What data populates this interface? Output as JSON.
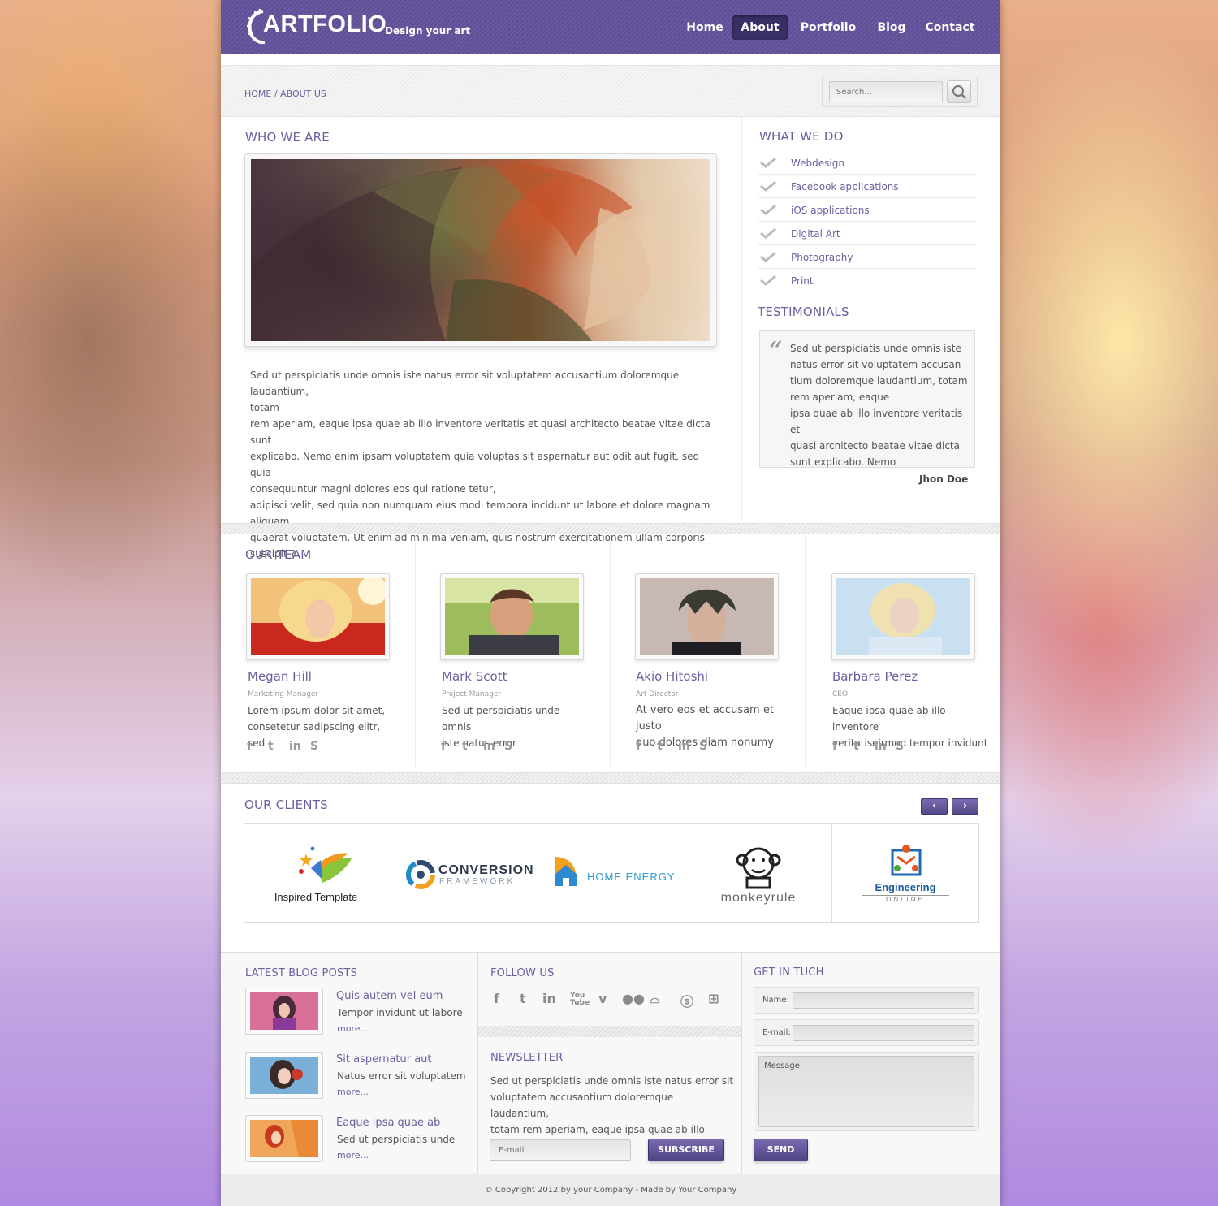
{
  "header": {
    "logo": "ARTFOLIO",
    "tagline": "Design your art",
    "nav": [
      {
        "label": "Home",
        "active": false
      },
      {
        "label": "About",
        "active": true
      },
      {
        "label": "Portfolio",
        "active": false
      },
      {
        "label": "Blog",
        "active": false
      },
      {
        "label": "Contact",
        "active": false
      }
    ]
  },
  "breadcrumb": "HOME / ABOUT US",
  "search": {
    "placeholder": "Search..."
  },
  "who_we_are": {
    "title": "WHO WE ARE",
    "lines": [
      "Sed ut perspiciatis unde omnis iste natus error sit voluptatem accusantium doloremque laudantium,",
      "totam",
      "rem aperiam, eaque ipsa quae ab illo inventore veritatis et quasi architecto beatae vitae dicta sunt",
      "explicabo. Nemo enim ipsam voluptatem quia voluptas sit aspernatur aut odit aut fugit, sed quia",
      "consequuntur magni dolores eos qui ratione tetur,",
      "adipisci velit, sed quia non numquam eius modi tempora incidunt ut labore et dolore magnam aliquam",
      "quaerat voluptatem. Ut enim ad minima veniam, quis nostrum exercitationem ullam corporis suscipit ?"
    ]
  },
  "what_we_do": {
    "title": "WHAT WE DO",
    "items": [
      "Webdesign",
      "Facebook applications",
      "iOS applications",
      "Digital Art",
      "Photography",
      "Print"
    ]
  },
  "testimonials": {
    "title": "TESTIMONIALS",
    "lines": [
      "Sed ut perspiciatis unde omnis iste",
      "natus error sit voluptatem accusan-",
      "tium doloremque laudantium, totam",
      "rem aperiam, eaque",
      "ipsa quae ab illo inventore veritatis et",
      "quasi architecto beatae vitae dicta",
      "sunt explicabo. Nemo"
    ],
    "author": "Jhon Doe"
  },
  "team": {
    "title": "OUR TEAM",
    "members": [
      {
        "name": "Megan Hill",
        "role": "Marketing Manager",
        "desc1": "Lorem ipsum dolor sit amet,",
        "desc2": "consetetur sadipscing elitr, sed"
      },
      {
        "name": "Mark Scott",
        "role": "Project Manager",
        "desc1": "Sed ut perspiciatis unde omnis",
        "desc2": "iste natus error"
      },
      {
        "name": "Akio Hitoshi",
        "role": "Art Director",
        "desc1": "At vero eos et accusam et justo",
        "desc2": "duo dolores diam nonumy"
      },
      {
        "name": "Barbara Perez",
        "role": "CEO",
        "desc1": "Eaque ipsa quae ab illo inventore",
        "desc2": "veritatiseirmod tempor invidunt"
      }
    ],
    "social": [
      "f",
      "t",
      "in",
      "S"
    ]
  },
  "clients": {
    "title": "OUR CLIENTS",
    "logos": [
      {
        "name": "Inspired Template",
        "line1": "Inspired Template",
        "line2": ""
      },
      {
        "name": "Conversion Framework",
        "line1": "CONVERSION",
        "line2": "FRAMEWORK"
      },
      {
        "name": "Home Energy",
        "line1": "HOME ENERGY",
        "line2": ""
      },
      {
        "name": "monkeyrule",
        "line1": "monkeyrule",
        "line2": ""
      },
      {
        "name": "Engineering Online",
        "line1": "Engineering",
        "line2": "ONLINE"
      }
    ],
    "prev": "‹",
    "next": "›"
  },
  "blog": {
    "title": "LATEST BLOG POSTS",
    "posts": [
      {
        "title": "Quis autem vel eum",
        "sub": "Tempor invidunt ut labore",
        "more": "more..."
      },
      {
        "title": "Sit aspernatur aut",
        "sub": "Natus error sit voluptatem",
        "more": "more..."
      },
      {
        "title": "Eaque ipsa quae ab",
        "sub": "Sed ut perspiciatis unde",
        "more": "more..."
      }
    ]
  },
  "follow": {
    "title": "FOLLOW US",
    "icons": [
      "facebook-icon",
      "twitter-icon",
      "linkedin-icon",
      "youtube-icon",
      "vimeo-icon",
      "flickr-icon",
      "delicious-icon",
      "stumbleupon-icon",
      "myspace-icon"
    ]
  },
  "newsletter": {
    "title": "NEWSLETTER",
    "lines": [
      "Sed ut perspiciatis unde omnis iste natus error sit",
      "voluptatem accusantium doloremque laudantium,",
      "totam rem aperiam, eaque ipsa quae ab illo invenvo-"
    ],
    "email_placeholder": "E-mail",
    "subscribe": "SUBSCRIBE"
  },
  "contact": {
    "title": "GET IN TUCH",
    "name_label": "Name:",
    "email_label": "E-mail:",
    "message_label": "Message:",
    "send": "SEND"
  },
  "footer": {
    "copyright": "© Copyright 2012 by your Company - Made by Your Company"
  },
  "colors": {
    "brand": "#5e4e94",
    "accent_text": "#6b5fa0"
  }
}
